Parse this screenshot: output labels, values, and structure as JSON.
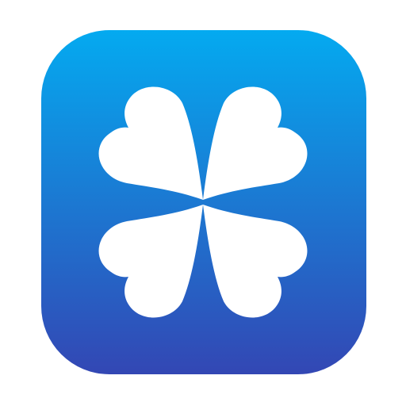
{
  "icon": {
    "name": "four-leaf-clover-icon",
    "colors": {
      "gradient_top": "#04aaf0",
      "gradient_bottom": "#3347b4",
      "clover": "#ffffff"
    }
  }
}
